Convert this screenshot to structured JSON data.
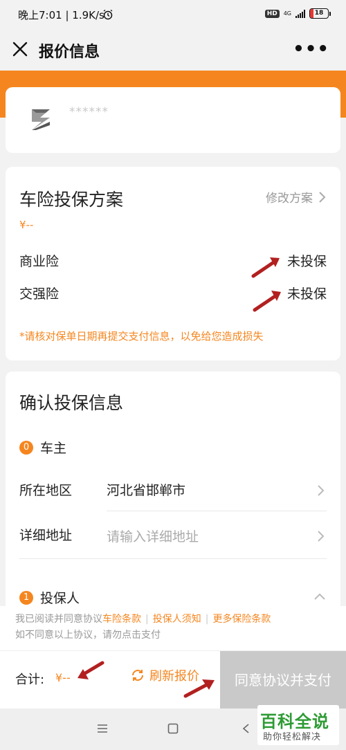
{
  "status": {
    "left": "晚上7:01 | 1.9K/s",
    "hd": "HD",
    "net": "4G",
    "battery_text": "18",
    "battery_level": 0.18
  },
  "header": {
    "title": "报价信息"
  },
  "car": {
    "name": "******"
  },
  "plan": {
    "title": "车险投保方案",
    "modify_label": "修改方案",
    "price": "¥--",
    "rows": [
      {
        "label": "商业险",
        "value": "未投保"
      },
      {
        "label": "交强险",
        "value": "未投保"
      }
    ],
    "notice": "*请核对保单日期再提交支付信息，以免给您造成损失"
  },
  "confirm": {
    "title": "确认投保信息",
    "sections": [
      {
        "badge": "0",
        "label": "车主"
      },
      {
        "badge": "1",
        "label": "投保人"
      }
    ],
    "fields": [
      {
        "label": "所在地区",
        "value": "河北省邯郸市"
      },
      {
        "label": "详细地址",
        "placeholder": "请输入详细地址"
      }
    ]
  },
  "agreement": {
    "prefix": "我已阅读并同意协议",
    "links": [
      "车险条款",
      "投保人须知",
      "更多保险条款"
    ],
    "line2": "如不同意以上协议，请勿点击支付"
  },
  "footer": {
    "total_label": "合计:",
    "total_value": "¥--",
    "refresh_label": "刷新报价",
    "pay_label": "同意协议并支付"
  },
  "watermark": {
    "big": "百科全说",
    "small": "助你轻松解决"
  },
  "colors": {
    "accent": "#f5861f",
    "annotation_arrow": "#b22020",
    "pay_disabled": "#c9c9c9"
  }
}
